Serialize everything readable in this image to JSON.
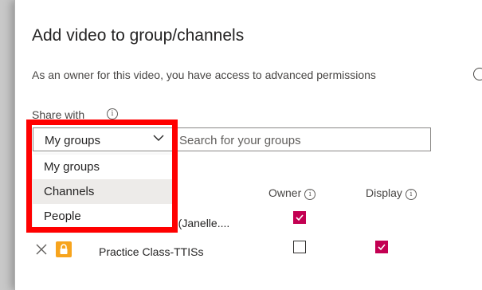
{
  "dialog": {
    "title": "Add video to group/channels",
    "info_text": "As an owner for this video, you have access to advanced permissions"
  },
  "share": {
    "label": "Share with",
    "info_icon": "info-icon",
    "dropdown_value": "My groups",
    "dropdown_options": [
      "My groups",
      "Channels",
      "People"
    ],
    "hovered_option": "Channels",
    "search_placeholder": "Search for your groups"
  },
  "table": {
    "columns": {
      "owner": "Owner",
      "display": "Display"
    },
    "rows": [
      {
        "name": "h (Janelle....",
        "owner_checked": true,
        "display_checked": null
      },
      {
        "name": "Practice Class-TTISs",
        "owner_checked": false,
        "display_checked": true
      }
    ]
  },
  "colors": {
    "accent_checkbox": "#c30052",
    "highlight_border": "#ff0000",
    "lock_badge": "#f7a41d"
  }
}
